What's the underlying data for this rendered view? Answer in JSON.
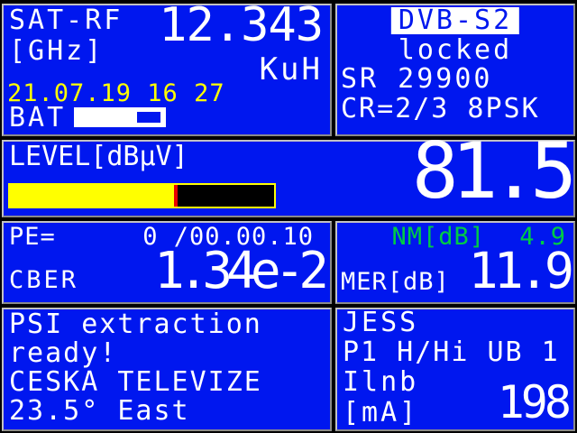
{
  "colors": {
    "screen-bg": "#000000",
    "panel-blue": "#0017ef",
    "border-light": "#c2c2c2",
    "border-dark": "#8a8a8a",
    "text": "#ffffff",
    "accent-yellow": "#ffff00",
    "accent-green": "#00cc44",
    "bar-red": "#e80000",
    "bar-black": "#000000",
    "invert-bg": "#ffffff"
  },
  "sat_rf": {
    "label": "SAT-RF",
    "unit": "[GHz]",
    "frequency": "12.343",
    "band": "KuH",
    "datetime": "21.07.19 16 27",
    "battery_label": "BAT"
  },
  "dvb": {
    "standard": "DVB-S2",
    "lock_status": "locked",
    "symbol_rate": "SR 29900",
    "code_rate": "CR=2/3 8PSK"
  },
  "level": {
    "label": "LEVEL[dBµV]",
    "value": "81.5",
    "bar_fill": "62%"
  },
  "per": {
    "label": "PE=",
    "value": "0 /00.00.10",
    "cber_label": "CBER",
    "cber_value": "1.34e-2"
  },
  "mer": {
    "nm_label": "NM[dB]",
    "nm_value": "4.9",
    "label": "MER[dB]",
    "value": "11.9"
  },
  "psi": {
    "line1": "PSI extraction",
    "line2": "ready!",
    "line3": "CESKA TELEVIZE",
    "line4": "23.5° East"
  },
  "lnb": {
    "mode": "JESS",
    "port": "P1 H/Hi UB 1",
    "current_label": "Ilnb",
    "current_unit": "[mA]",
    "current_value": "198"
  }
}
